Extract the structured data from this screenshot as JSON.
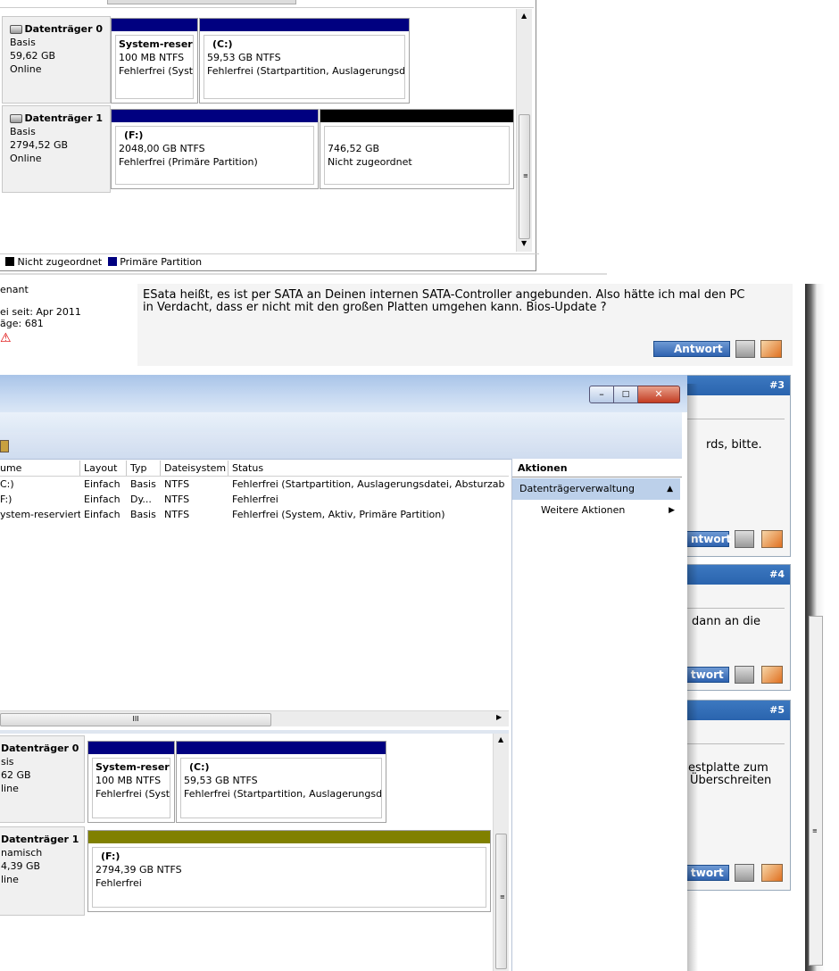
{
  "top_disk_mgmt": {
    "disks": [
      {
        "name": "Datenträger 0",
        "type": "Basis",
        "size": "59,62 GB",
        "status": "Online",
        "partitions": [
          {
            "label": "System-reserv",
            "size": "100 MB NTFS",
            "status": "Fehlerfrei (Syste"
          },
          {
            "label": "(C:)",
            "size": "59,53 GB NTFS",
            "status": "Fehlerfrei (Startpartition, Auslagerungsdat"
          }
        ]
      },
      {
        "name": "Datenträger 1",
        "type": "Basis",
        "size": "2794,52 GB",
        "status": "Online",
        "partitions": [
          {
            "label": "(F:)",
            "size": "2048,00 GB NTFS",
            "status": "Fehlerfrei (Primäre Partition)"
          },
          {
            "label": "",
            "size": "746,52 GB",
            "status": "Nicht zugeordnet"
          }
        ]
      }
    ],
    "legend": [
      {
        "label": "Nicht zugeordnet",
        "color": "#000000"
      },
      {
        "label": "Primäre Partition",
        "color": "#000080"
      }
    ]
  },
  "forum": {
    "user_info": {
      "rank": "enant",
      "since": "ei seit: Apr 2011",
      "posts": "äge: 681"
    },
    "post_text": "ESata heißt, es ist per SATA an Deinen internen SATA-Controller angebunden. Also hätte ich mal den PC in Verdacht, dass er nicht mit den großen Platten umgehen kann. Bios-Update ?",
    "reply_label": "Antwort",
    "reply_label_partial": "twort",
    "reply_label_partial2": "ntwort",
    "posts": [
      {
        "num": "#3",
        "text": "rds, bitte."
      },
      {
        "num": "#4",
        "text": "dann an die"
      },
      {
        "num": "#5",
        "text_line1": "estplatte zum",
        "text_line2": "Überschreiten"
      }
    ]
  },
  "win": {
    "columns": [
      "ume",
      "Layout",
      "Typ",
      "Dateisystem",
      "Status"
    ],
    "rows": [
      [
        "C:)",
        "Einfach",
        "Basis",
        "NTFS",
        "Fehlerfrei (Startpartition, Auslagerungsdatei, Absturzabbild"
      ],
      [
        "F:)",
        "Einfach",
        "Dy...",
        "NTFS",
        "Fehlerfrei"
      ],
      [
        "ystem-reserviert",
        "Einfach",
        "Basis",
        "NTFS",
        "Fehlerfrei (System, Aktiv, Primäre Partition)"
      ]
    ],
    "scroll_mark": "III",
    "actions_title": "Aktionen",
    "actions_section": "Datenträgerverwaltung",
    "actions_more": "Weitere Aktionen",
    "disks": [
      {
        "name": "Datenträger 0",
        "type": "sis",
        "size": "62 GB",
        "status": "line",
        "partitions": [
          {
            "label": "System-reserv",
            "size": "100 MB NTFS",
            "status": "Fehlerfrei (Syste"
          },
          {
            "label": "(C:)",
            "size": "59,53 GB NTFS",
            "status": "Fehlerfrei (Startpartition, Auslagerungsdat"
          }
        ]
      },
      {
        "name": "Datenträger 1",
        "type": "namisch",
        "size": "4,39 GB",
        "status": "line",
        "partitions": [
          {
            "label": "(F:)",
            "size": "2794,39 GB NTFS",
            "status": "Fehlerfrei"
          }
        ]
      }
    ],
    "colors": {
      "primary_bar": "#000080",
      "unallocated_bar": "#000000",
      "dynamic_bar": "#808000",
      "action_section_bg": "#bcd0ea"
    }
  }
}
